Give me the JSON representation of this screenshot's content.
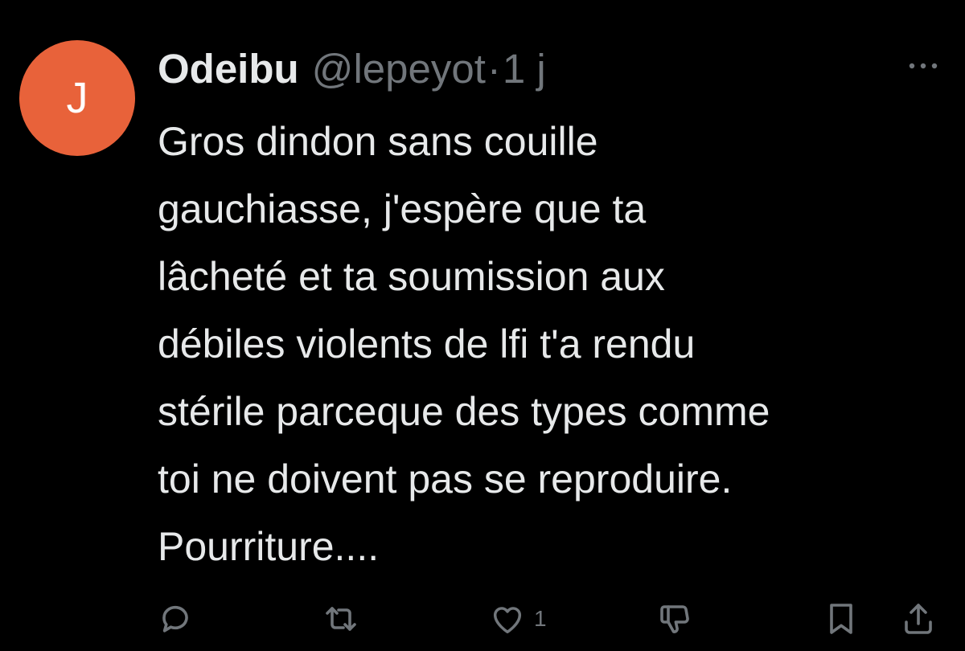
{
  "tweet": {
    "avatar_letter": "J",
    "display_name": "Odeibu",
    "handle": "@lepeyot",
    "separator": "·",
    "time": "1 j",
    "text_lines": [
      "Gros dindon sans couille",
      "gauchiasse, j'espère que ta",
      "lâcheté et ta soumission aux",
      "débiles violents de lfi t'a rendu",
      "stérile parceque des types comme",
      "toi ne doivent pas se reproduire.",
      "Pourriture...."
    ],
    "actions": {
      "reply_icon": "reply-icon",
      "retweet_icon": "retweet-icon",
      "like_icon": "heart-icon",
      "like_count": "1",
      "dislike_icon": "thumbs-down-icon",
      "bookmark_icon": "bookmark-icon",
      "share_icon": "share-icon"
    },
    "colors": {
      "background": "#000000",
      "text": "#e7e9ea",
      "secondary": "#71767b",
      "avatar": "#e8623a"
    }
  }
}
